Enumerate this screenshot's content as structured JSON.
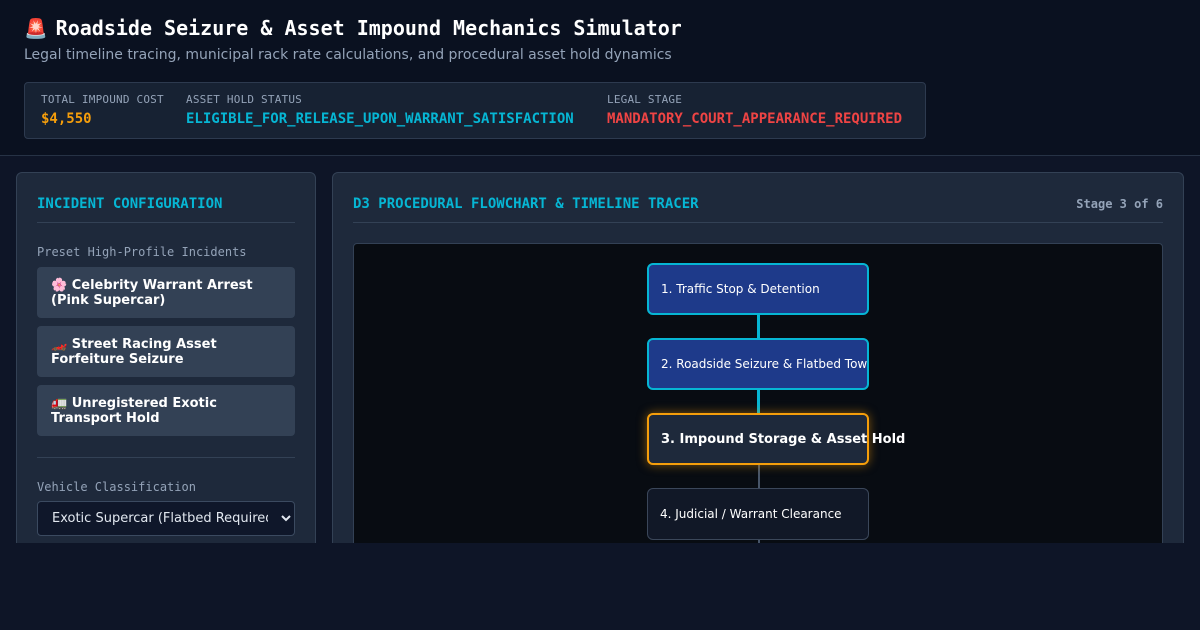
{
  "header": {
    "title_icon": "🚨",
    "title": "Roadside Seizure & Asset Impound Mechanics Simulator",
    "subtitle": "Legal timeline tracing, municipal rack rate calculations, and procedural asset hold dynamics"
  },
  "status": {
    "total_cost_label": "TOTAL IMPOUND COST",
    "total_cost_value": "$4,550",
    "hold_status_label": "ASSET HOLD STATUS",
    "hold_status_value": "ELIGIBLE_FOR_RELEASE_UPON_WARRANT_SATISFACTION",
    "legal_stage_label": "LEGAL STAGE",
    "legal_stage_value": "MANDATORY_COURT_APPEARANCE_REQUIRED",
    "colors": {
      "cost": "#f59e0b",
      "hold": "#06b6d4",
      "stage": "#ef4444"
    }
  },
  "config": {
    "title": "INCIDENT CONFIGURATION",
    "presets_label": "Preset High-Profile Incidents",
    "presets": [
      {
        "icon": "🌸",
        "label": "Celebrity Warrant Arrest (Pink Supercar)"
      },
      {
        "icon": "🏎️",
        "label": "Street Racing Asset Forfeiture Seizure"
      },
      {
        "icon": "🚛",
        "label": "Unregistered Exotic Transport Hold"
      }
    ],
    "vehicle_label": "Vehicle Classification",
    "vehicle_selected": "Exotic Supercar (Flatbed Required)"
  },
  "flowchart": {
    "title": "D3 PROCEDURAL FLOWCHART & TIMELINE TRACER",
    "stage_indicator": "Stage 3 of 6",
    "nodes": [
      {
        "label": "1. Traffic Stop & Detention",
        "state": "done"
      },
      {
        "label": "2. Roadside Seizure & Flatbed Tow",
        "state": "done"
      },
      {
        "label": "3. Impound Storage & Asset Hold",
        "state": "active"
      },
      {
        "label": "4. Judicial / Warrant Clearance",
        "state": "pending"
      }
    ]
  }
}
